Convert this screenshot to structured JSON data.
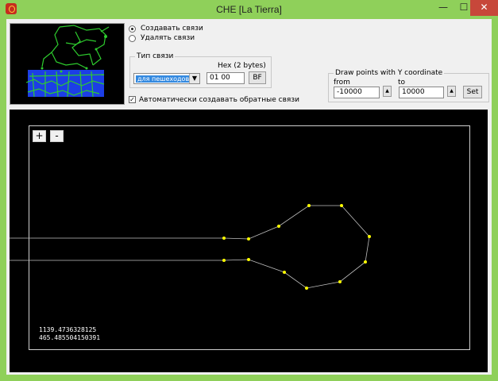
{
  "window": {
    "title": "CHE [La Tierra]",
    "min_symbol": "—",
    "max_symbol": "☐",
    "close_symbol": "✕"
  },
  "mode": {
    "create_label": "Создавать связи",
    "delete_label": "Удалять связи",
    "selected": "create"
  },
  "link_type": {
    "legend": "Тип связи",
    "hex_label": "Hex (2 bytes)",
    "select_value": "для пешеходов",
    "hex_value": "01 00",
    "bf_label": "BF"
  },
  "auto_reverse": {
    "label": "Автоматически создавать обратные связи",
    "checked": true
  },
  "draw_points": {
    "legend": "Draw points with  Y coordinate",
    "from_label": "from",
    "to_label": "to",
    "from_value": "-10000",
    "to_value": "10000",
    "spin_symbol": "▲",
    "set_label": "Set"
  },
  "zoom": {
    "plus": "+",
    "minus": "-"
  },
  "coords": {
    "x": "1139.4736328125",
    "y": "465.485504150391"
  },
  "colors": {
    "window_frame": "#8fd05a",
    "close_button": "#c7473a",
    "canvas_bg": "#000000",
    "node": "#ffff00",
    "edge": "#bfbfbf",
    "minimap_road": "#2ecc2e",
    "minimap_area": "#1c3ee6"
  }
}
